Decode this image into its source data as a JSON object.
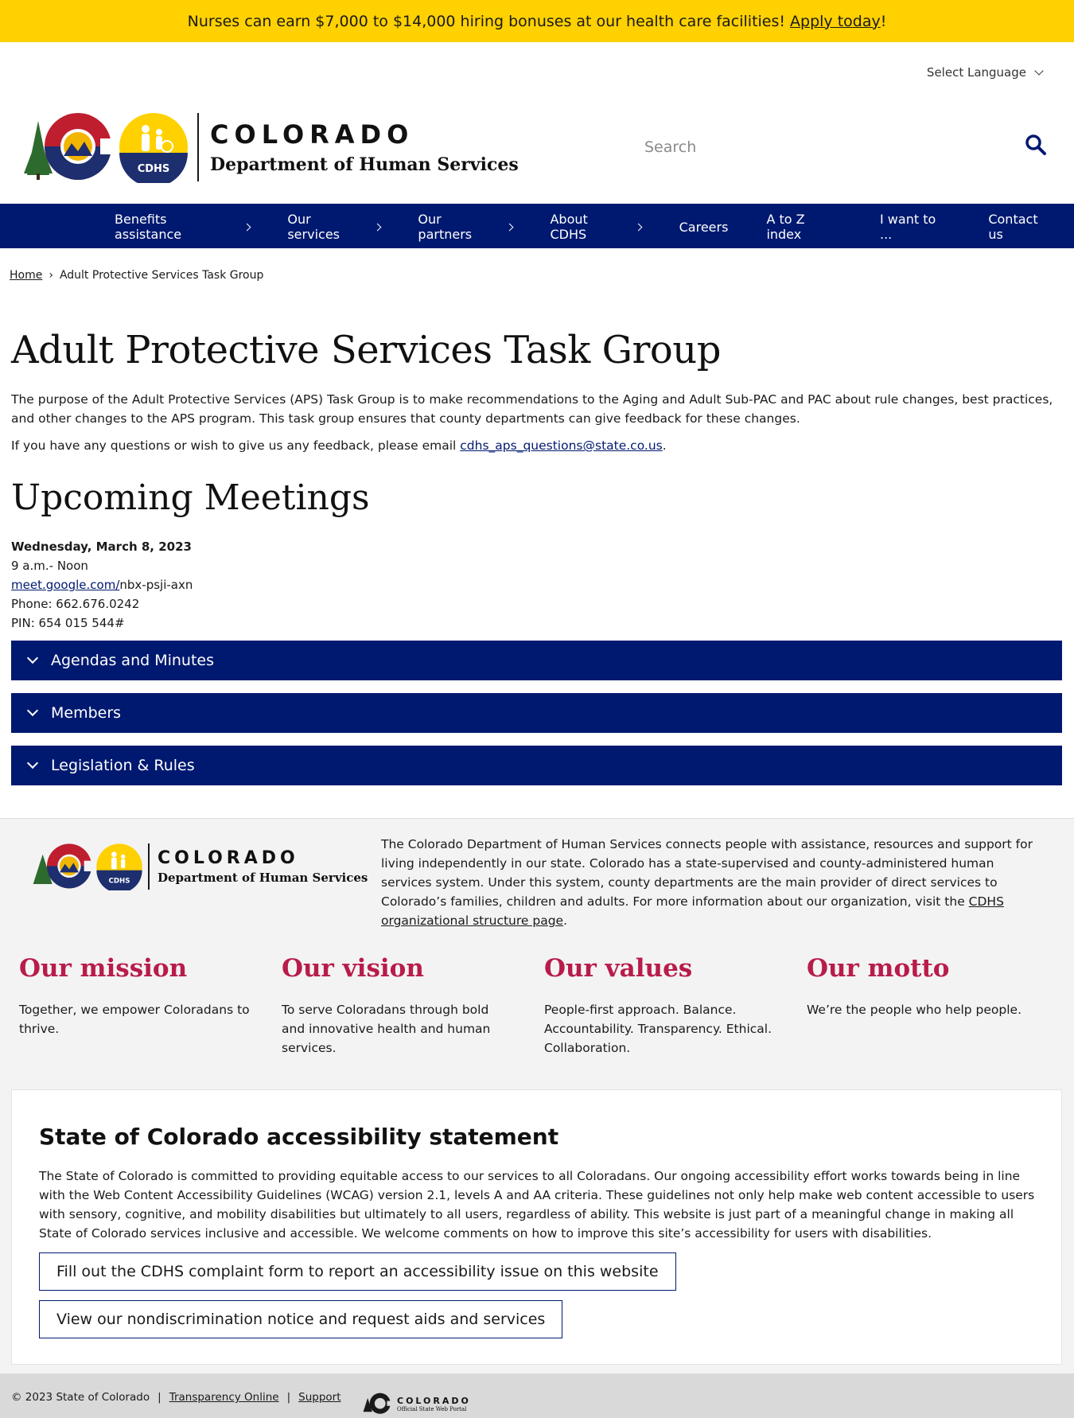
{
  "banner": {
    "text": "Nurses can earn $7,000 to $14,000 hiring bonuses at our health care facilities!",
    "link": "Apply today",
    "suffix": "!"
  },
  "language": {
    "label": "Select Language"
  },
  "logo": {
    "state": "COLORADO",
    "dept": "Department of Human Services",
    "badge": "CDHS"
  },
  "search": {
    "placeholder": "Search"
  },
  "nav": {
    "items": [
      {
        "label": "Benefits assistance"
      },
      {
        "label": "Our services"
      },
      {
        "label": "Our partners"
      },
      {
        "label": "About CDHS"
      },
      {
        "label": "Careers"
      },
      {
        "label": "A to Z index"
      },
      {
        "label": "I want to ..."
      },
      {
        "label": "Contact us"
      }
    ]
  },
  "breadcrumb": {
    "home": "Home",
    "sep": "›",
    "current": "Adult Protective Services Task Group"
  },
  "page": {
    "title": "Adult Protective Services Task Group",
    "intro": "The purpose of the Adult Protective Services (APS) Task Group is to make recommendations to the Aging and Adult Sub-PAC and PAC about rule changes, best practices, and other changes to the APS program. This task group ensures that county departments can give feedback for these changes.",
    "feedback_prefix": "If you have any questions or wish to give us any feedback, please email",
    "email": "cdhs_aps_questions@state.co.us",
    "feedback_suffix": "."
  },
  "meetings": {
    "heading": "Upcoming Meetings",
    "date": "Wednesday, March 8, 2023",
    "time": "9 a.m.- Noon",
    "link_base": "meet.google.com/",
    "link_code": "nbx-psji-axn",
    "phone": "Phone: 662.676.0242",
    "pin": "PIN: 654 015 544#"
  },
  "accordions": [
    {
      "label": "Agendas and Minutes"
    },
    {
      "label": "Members"
    },
    {
      "label": "Legislation & Rules"
    }
  ],
  "footer": {
    "about": "The Colorado Department of Human Services connects people with assistance, resources and support for living independently in our state. Colorado has a state-supervised and county-administered human services system. Under this system, county departments are the main provider of direct services to Colorado’s families, children and adults. For more information about our organization, visit the",
    "about_link": "CDHS organizational structure page",
    "about_suffix": ".",
    "pillars": [
      {
        "title": "Our mission",
        "text": "Together, we empower Coloradans to thrive."
      },
      {
        "title": "Our vision",
        "text": "To serve Coloradans through bold and innovative health and human services."
      },
      {
        "title": "Our values",
        "text": "People-first approach. Balance. Accountability. Transparency. Ethical. Collaboration."
      },
      {
        "title": "Our motto",
        "text": "We’re the people who help people."
      }
    ]
  },
  "accessibility": {
    "heading": "State of Colorado accessibility statement",
    "text": "The State of Colorado is committed to providing equitable access to our services to all Coloradans. Our ongoing accessibility effort works towards being in line with the Web Content Accessibility Guidelines (WCAG) version 2.1, levels A and AA criteria. These guidelines not only help make web content accessible to users with sensory, cognitive, and mobility disabilities but ultimately to all users, regardless of ability. This website is just part of a meaningful change in making all State of Colorado services inclusive and accessible. We welcome comments on how to improve this site’s accessibility for users with disabilities.",
    "btn1": "Fill out the CDHS complaint form to report an accessibility issue on this website",
    "btn2": "View our nondiscrimination notice and request aids and services"
  },
  "bottom": {
    "copyright": "© 2023 State of Colorado",
    "sep": "|",
    "link1": "Transparency Online",
    "link2": "Support",
    "portal_title": "COLORADO",
    "portal_sub": "Official State Web Portal"
  },
  "colors": {
    "banner": "#ffd100",
    "navy": "#001970",
    "crimson": "#b81c4a",
    "footer_bg": "#f3f3f3"
  }
}
